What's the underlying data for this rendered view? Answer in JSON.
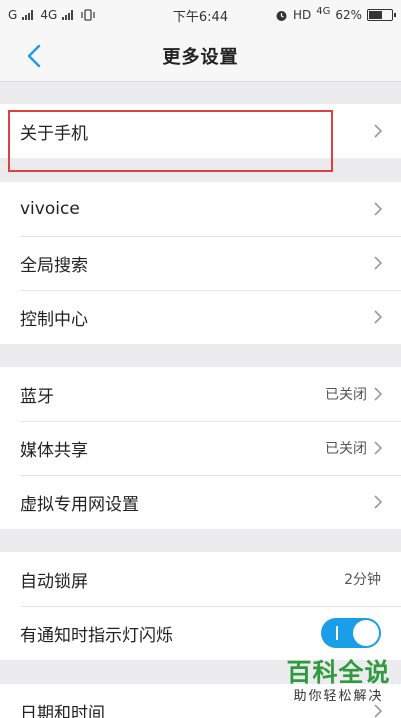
{
  "status_bar": {
    "left_carrier": "G",
    "left_network": "4G",
    "time": "下午6:44",
    "hd_label": "HD",
    "right_network": "4G",
    "battery_percent_text": "62%",
    "battery_level": 0.62
  },
  "nav": {
    "title": "更多设置",
    "back_icon": "chevron-left-icon",
    "accent_color": "#1a9ee8"
  },
  "groups": [
    {
      "rows": [
        {
          "label": "关于手机",
          "value": "",
          "chevron": true
        }
      ]
    },
    {
      "rows": [
        {
          "label": "vivoice",
          "value": "",
          "chevron": true
        },
        {
          "label": "全局搜索",
          "value": "",
          "chevron": true
        },
        {
          "label": "控制中心",
          "value": "",
          "chevron": true
        }
      ]
    },
    {
      "rows": [
        {
          "label": "蓝牙",
          "value": "已关闭",
          "chevron": true
        },
        {
          "label": "媒体共享",
          "value": "已关闭",
          "chevron": true
        },
        {
          "label": "虚拟专用网设置",
          "value": "",
          "chevron": true
        }
      ]
    },
    {
      "rows": [
        {
          "label": "自动锁屏",
          "value": "2分钟",
          "chevron": false
        },
        {
          "label": "有通知时指示灯闪烁",
          "toggle_on": true
        }
      ]
    },
    {
      "rows": [
        {
          "label": "日期和时间",
          "value": "",
          "chevron": true
        }
      ]
    }
  ],
  "highlight_color": "#e0403f",
  "watermark": {
    "title": "百科全说",
    "subtitle": "助你轻松解决"
  }
}
